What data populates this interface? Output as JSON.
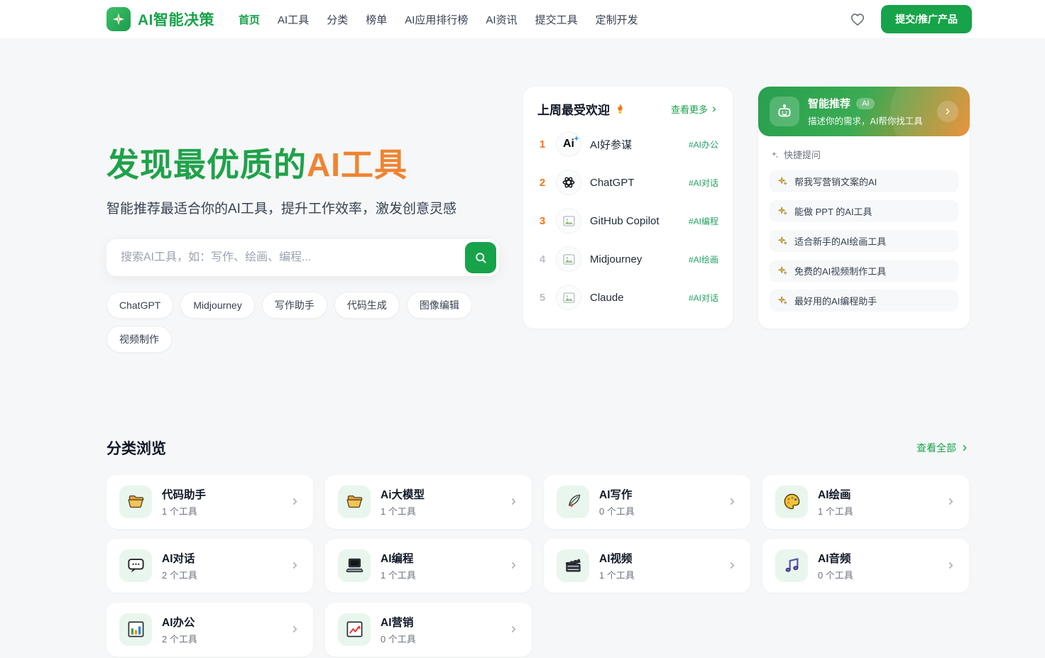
{
  "colors": {
    "primary": "#17a34a",
    "accent_orange": "#ef8432",
    "rank_orange": "#f97316",
    "tag_green": "#22a063"
  },
  "header": {
    "logo_text": "AI智能决策",
    "nav": [
      {
        "label": "首页",
        "active": true
      },
      {
        "label": "AI工具",
        "active": false
      },
      {
        "label": "分类",
        "active": false
      },
      {
        "label": "榜单",
        "active": false
      },
      {
        "label": "AI应用排行榜",
        "active": false
      },
      {
        "label": "AI资讯",
        "active": false
      },
      {
        "label": "提交工具",
        "active": false
      },
      {
        "label": "定制开发",
        "active": false
      }
    ],
    "submit_label": "提交/推广产品"
  },
  "hero": {
    "title_green": "发现最优质的",
    "title_orange": "AI工具",
    "subtitle": "智能推荐最适合你的AI工具，提升工作效率，激发创意灵感",
    "search_placeholder": "搜索AI工具，如：写作、绘画、编程...",
    "tags": [
      "ChatGPT",
      "Midjourney",
      "写作助手",
      "代码生成",
      "图像编辑",
      "视频制作"
    ]
  },
  "popular": {
    "title": "上周最受欢迎",
    "more_label": "查看更多",
    "items": [
      {
        "rank": "1",
        "name": "AI好参谋",
        "tag": "#AI办公",
        "icon": "ai-wordmark"
      },
      {
        "rank": "2",
        "name": "ChatGPT",
        "tag": "#AI对话",
        "icon": "openai"
      },
      {
        "rank": "3",
        "name": "GitHub Copilot",
        "tag": "#AI编程",
        "icon": "broken-image"
      },
      {
        "rank": "4",
        "name": "Midjourney",
        "tag": "#AI绘画",
        "icon": "broken-image"
      },
      {
        "rank": "5",
        "name": "Claude",
        "tag": "#AI对话",
        "icon": "broken-image"
      }
    ]
  },
  "recommend": {
    "title": "智能推荐",
    "badge": "AI",
    "subtitle": "描述你的需求，AI帮你找工具",
    "quick_label": "快捷提问",
    "questions": [
      "帮我写营销文案的AI",
      "能做 PPT 的AI工具",
      "适合新手的AI绘画工具",
      "免费的AI视频制作工具",
      "最好用的AI编程助手"
    ]
  },
  "categories": {
    "title": "分类浏览",
    "view_all": "查看全部",
    "items": [
      {
        "name": "代码助手",
        "count": "1 个工具",
        "icon": "folder"
      },
      {
        "name": "Ai大模型",
        "count": "1 个工具",
        "icon": "folder"
      },
      {
        "name": "AI写作",
        "count": "0 个工具",
        "icon": "feather"
      },
      {
        "name": "AI绘画",
        "count": "1 个工具",
        "icon": "palette"
      },
      {
        "name": "AI对话",
        "count": "2 个工具",
        "icon": "chat"
      },
      {
        "name": "AI编程",
        "count": "1 个工具",
        "icon": "laptop"
      },
      {
        "name": "AI视频",
        "count": "1 个工具",
        "icon": "clapper"
      },
      {
        "name": "AI音频",
        "count": "0 个工具",
        "icon": "music"
      },
      {
        "name": "AI办公",
        "count": "2 个工具",
        "icon": "bar-chart"
      },
      {
        "name": "AI营销",
        "count": "0 个工具",
        "icon": "chart-up"
      }
    ]
  }
}
